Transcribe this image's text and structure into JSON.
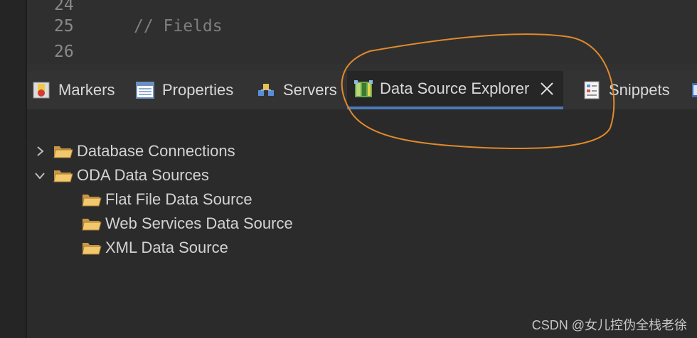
{
  "editor": {
    "lines": [
      {
        "number": "24",
        "code": ""
      },
      {
        "number": "25",
        "code": "// Fields"
      },
      {
        "number": "26",
        "code": ""
      }
    ]
  },
  "tabs": [
    {
      "label": "Markers",
      "icon": "markers-icon"
    },
    {
      "label": "Properties",
      "icon": "properties-icon"
    },
    {
      "label": "Servers",
      "icon": "servers-icon"
    },
    {
      "label": "Data Source Explorer",
      "icon": "data-source-explorer-icon",
      "active": true
    },
    {
      "label": "Snippets",
      "icon": "snippets-icon"
    }
  ],
  "tree": {
    "items": [
      {
        "label": "Database Connections",
        "expanded": false,
        "level": 0
      },
      {
        "label": "ODA Data Sources",
        "expanded": true,
        "level": 0
      },
      {
        "label": "Flat File Data Source",
        "level": 1
      },
      {
        "label": "Web Services Data Source",
        "level": 1
      },
      {
        "label": "XML Data Source",
        "level": 1
      }
    ]
  },
  "watermark": "CSDN @女儿控伪全栈老徐",
  "colors": {
    "background": "#2b2b2b",
    "active_tab_underline": "#4b7ab8",
    "annotation_circle": "#e08a2c",
    "folder": "#e4b96a"
  }
}
